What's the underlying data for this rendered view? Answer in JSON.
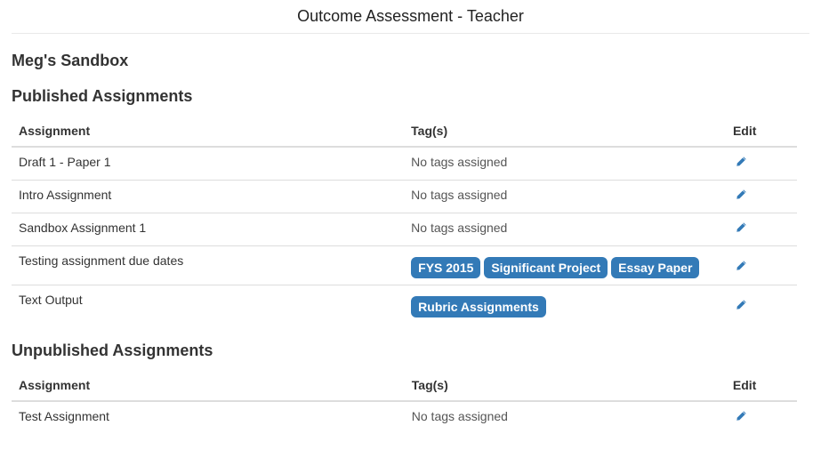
{
  "header": {
    "title": "Outcome Assessment - Teacher"
  },
  "course": {
    "name": "Meg's Sandbox"
  },
  "colors": {
    "tag_background": "#337ab7",
    "edit_icon": "#337ab7"
  },
  "published": {
    "title": "Published Assignments",
    "columns": [
      "Assignment",
      "Tag(s)",
      "Edit"
    ],
    "rows": [
      {
        "name": "Draft 1 - Paper 1",
        "tags": [],
        "no_tags_text": "No tags assigned",
        "edit_icon": "pencil-icon"
      },
      {
        "name": "Intro Assignment",
        "tags": [],
        "no_tags_text": "No tags assigned",
        "edit_icon": "pencil-icon"
      },
      {
        "name": "Sandbox Assignment 1",
        "tags": [],
        "no_tags_text": "No tags assigned",
        "edit_icon": "pencil-icon"
      },
      {
        "name": "Testing assignment due dates",
        "tags": [
          "FYS 2015",
          "Significant Project",
          "Essay Paper"
        ],
        "no_tags_text": "",
        "edit_icon": "pencil-icon"
      },
      {
        "name": "Text Output",
        "tags": [
          "Rubric Assignments"
        ],
        "no_tags_text": "",
        "edit_icon": "pencil-icon"
      }
    ]
  },
  "unpublished": {
    "title": "Unpublished Assignments",
    "columns": [
      "Assignment",
      "Tag(s)",
      "Edit"
    ],
    "rows": [
      {
        "name": "Test Assignment",
        "tags": [],
        "no_tags_text": "No tags assigned",
        "edit_icon": "pencil-icon"
      }
    ]
  }
}
